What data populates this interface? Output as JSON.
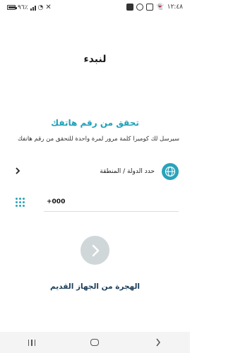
{
  "status_bar": {
    "time": "١٢:٤٨",
    "battery": "٩٦٪",
    "battery_level": 0.96,
    "left_icons": [
      "x-icon",
      "wifi-icon",
      "signal-icon",
      "battery-icon"
    ],
    "right_icons": [
      "snapchat-icon",
      "app-icon",
      "camera-icon",
      "notification-icon"
    ]
  },
  "page": {
    "heading": "لنبدء",
    "verify_title": "تحقق من رقم هاتفك",
    "info_text": "سيرسل لك كوميرا كلمة مرور لمرة واحدة للتحقق من رقم هاتفك"
  },
  "country": {
    "label": "حدد الدولة / المنطقة",
    "icons": {
      "globe": "globe-icon",
      "chevron": "chevron-right-icon"
    }
  },
  "phone": {
    "value": "+000",
    "icon": "dialpad-icon"
  },
  "next_button": {
    "icon": "chevron-right-icon"
  },
  "migrate_link": "الهجرة من الجهاز القديم",
  "nav_bar": {
    "buttons": [
      "recents-icon",
      "home-icon",
      "back-icon"
    ]
  },
  "colors": {
    "accent": "#1da1b9",
    "globe_bg": "#2aa3ba",
    "next_button_bg": "#cfd7d9",
    "migrate_text": "#1c3e5a"
  }
}
